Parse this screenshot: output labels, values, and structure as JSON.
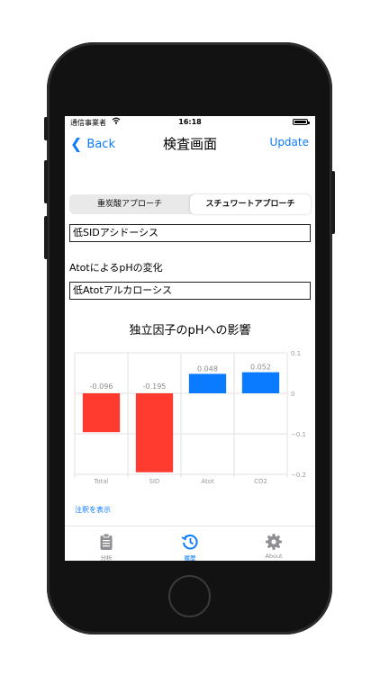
{
  "status": {
    "carrier": "通信事業者",
    "time": "16:18"
  },
  "nav": {
    "back": "Back",
    "title": "検査画面",
    "update": "Update"
  },
  "segments": {
    "left": "重炭酸アプローチ",
    "right": "スチュワートアプローチ",
    "selected": "right"
  },
  "result1": "低SIDアシドーシス",
  "section_label": "AtotによるpHの変化",
  "result2": "低Atotアルカローシス",
  "chart_data": {
    "type": "bar",
    "title": "独立因子のpHへの影響",
    "categories": [
      "Total",
      "SID",
      "Atot",
      "CO2"
    ],
    "values": [
      -0.096,
      -0.195,
      0.048,
      0.052
    ],
    "value_labels": [
      "-0.096",
      "-0.195",
      "0.048",
      "0.052"
    ],
    "colors": [
      "#ff3b30",
      "#ff3b30",
      "#0a7aff",
      "#0a7aff"
    ],
    "ylim": [
      -0.2,
      0.1
    ],
    "yticks": [
      0.1,
      0,
      -0.1,
      -0.2
    ],
    "ytick_labels": [
      "0.1",
      "0",
      "−0.1",
      "−0.2"
    ],
    "y_axis_side": "right",
    "grid": true
  },
  "note_link": "注釈を表示",
  "tabs": [
    {
      "label": "分析",
      "icon": "clipboard-icon",
      "active": false
    },
    {
      "label": "履歴",
      "icon": "history-icon",
      "active": true
    },
    {
      "label": "About",
      "icon": "gear-icon",
      "active": false
    }
  ]
}
